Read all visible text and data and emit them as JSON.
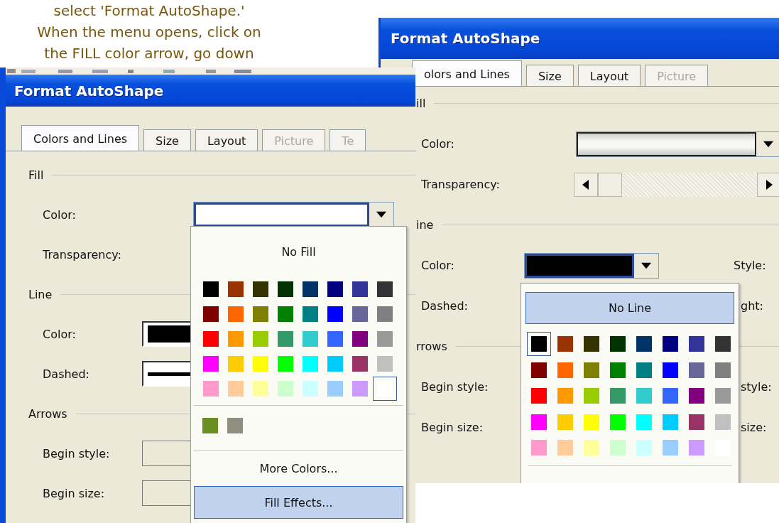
{
  "caption_lines": [
    "select 'Format AutoShape.'",
    "When the menu opens, click on",
    "the FILL color arrow, go down"
  ],
  "back_window": {
    "title": "Format AutoShape",
    "tabs": [
      {
        "label": "olors and Lines",
        "selected": true,
        "disabled": false
      },
      {
        "label": "Size",
        "selected": false,
        "disabled": false
      },
      {
        "label": "Layout",
        "selected": false,
        "disabled": false
      },
      {
        "label": "Picture",
        "selected": false,
        "disabled": true
      }
    ],
    "fill": {
      "heading": "ill",
      "color_label": "Color:",
      "color": "#f6f6f2",
      "transparency_label": "Transparency:",
      "level": 0
    },
    "line": {
      "heading": "ine",
      "color_label": "Color:",
      "color": "#000000",
      "style_label": "Style:",
      "dashed_label": "Dashed:",
      "weight_label": "ght:"
    },
    "arrows": {
      "heading": "rrows",
      "begin_style_label": "Begin style:",
      "end_style_label": "style:",
      "begin_size_label": "Begin size:",
      "end_size_label": "size:"
    },
    "popup": {
      "top_item": {
        "label": "No Line",
        "selected": true
      },
      "swatches": [
        {
          "color": "#000000",
          "selected": true
        },
        {
          "color": "#993300",
          "selected": false
        },
        {
          "color": "#333300",
          "selected": false
        },
        {
          "color": "#003300",
          "selected": false
        },
        {
          "color": "#003366",
          "selected": false
        },
        {
          "color": "#000080",
          "selected": false
        },
        {
          "color": "#333399",
          "selected": false
        },
        {
          "color": "#333333",
          "selected": false
        },
        {
          "color": "#800000",
          "selected": false
        },
        {
          "color": "#ff6600",
          "selected": false
        },
        {
          "color": "#808000",
          "selected": false
        },
        {
          "color": "#008000",
          "selected": false
        },
        {
          "color": "#008080",
          "selected": false
        },
        {
          "color": "#0000ff",
          "selected": false
        },
        {
          "color": "#666699",
          "selected": false
        },
        {
          "color": "#808080",
          "selected": false
        },
        {
          "color": "#ff0000",
          "selected": false
        },
        {
          "color": "#ff9900",
          "selected": false
        },
        {
          "color": "#99cc00",
          "selected": false
        },
        {
          "color": "#339966",
          "selected": false
        },
        {
          "color": "#33cccc",
          "selected": false
        },
        {
          "color": "#3366ff",
          "selected": false
        },
        {
          "color": "#800080",
          "selected": false
        },
        {
          "color": "#999999",
          "selected": false
        },
        {
          "color": "#ff00ff",
          "selected": false
        },
        {
          "color": "#ffcc00",
          "selected": false
        },
        {
          "color": "#ffff00",
          "selected": false
        },
        {
          "color": "#00ff00",
          "selected": false
        },
        {
          "color": "#00ffff",
          "selected": false
        },
        {
          "color": "#00ccff",
          "selected": false
        },
        {
          "color": "#993366",
          "selected": false
        },
        {
          "color": "#c0c0c0",
          "selected": false
        },
        {
          "color": "#ff99cc",
          "selected": false
        },
        {
          "color": "#ffcc99",
          "selected": false
        },
        {
          "color": "#ffff99",
          "selected": false
        },
        {
          "color": "#ccffcc",
          "selected": false
        },
        {
          "color": "#ccffff",
          "selected": false
        },
        {
          "color": "#99ccff",
          "selected": false
        },
        {
          "color": "#cc99ff",
          "selected": false
        },
        {
          "color": "#ffffff",
          "selected": false
        }
      ]
    }
  },
  "front_window": {
    "title": "Format AutoShape",
    "tabs": [
      {
        "label": "Colors and Lines",
        "selected": true,
        "disabled": false
      },
      {
        "label": "Size",
        "selected": false,
        "disabled": false
      },
      {
        "label": "Layout",
        "selected": false,
        "disabled": false
      },
      {
        "label": "Picture",
        "selected": false,
        "disabled": true
      },
      {
        "label": "Te",
        "selected": false,
        "disabled": true
      }
    ],
    "fill": {
      "heading": "Fill",
      "color_label": "Color:",
      "color": "#ffffff",
      "transparency_label": "Transparency:"
    },
    "line": {
      "heading": "Line",
      "color_label": "Color:",
      "color": "#000000",
      "dashed_label": "Dashed:"
    },
    "arrows": {
      "heading": "Arrows",
      "begin_style_label": "Begin style:",
      "begin_size_label": "Begin size:"
    },
    "popup": {
      "top_item": {
        "label": "No Fill",
        "selected": false
      },
      "swatches": [
        {
          "color": "#000000",
          "selected": false
        },
        {
          "color": "#993300",
          "selected": false
        },
        {
          "color": "#333300",
          "selected": false
        },
        {
          "color": "#003300",
          "selected": false
        },
        {
          "color": "#003366",
          "selected": false
        },
        {
          "color": "#000080",
          "selected": false
        },
        {
          "color": "#333399",
          "selected": false
        },
        {
          "color": "#333333",
          "selected": false
        },
        {
          "color": "#800000",
          "selected": false
        },
        {
          "color": "#ff6600",
          "selected": false
        },
        {
          "color": "#808000",
          "selected": false
        },
        {
          "color": "#008000",
          "selected": false
        },
        {
          "color": "#008080",
          "selected": false
        },
        {
          "color": "#0000ff",
          "selected": false
        },
        {
          "color": "#666699",
          "selected": false
        },
        {
          "color": "#808080",
          "selected": false
        },
        {
          "color": "#ff0000",
          "selected": false
        },
        {
          "color": "#ff9900",
          "selected": false
        },
        {
          "color": "#99cc00",
          "selected": false
        },
        {
          "color": "#339966",
          "selected": false
        },
        {
          "color": "#33cccc",
          "selected": false
        },
        {
          "color": "#3366ff",
          "selected": false
        },
        {
          "color": "#800080",
          "selected": false
        },
        {
          "color": "#999999",
          "selected": false
        },
        {
          "color": "#ff00ff",
          "selected": false
        },
        {
          "color": "#ffcc00",
          "selected": false
        },
        {
          "color": "#ffff00",
          "selected": false
        },
        {
          "color": "#00ff00",
          "selected": false
        },
        {
          "color": "#00ffff",
          "selected": false
        },
        {
          "color": "#00ccff",
          "selected": false
        },
        {
          "color": "#993366",
          "selected": false
        },
        {
          "color": "#c0c0c0",
          "selected": false
        },
        {
          "color": "#ff99cc",
          "selected": false
        },
        {
          "color": "#ffcc99",
          "selected": false
        },
        {
          "color": "#ffff99",
          "selected": false
        },
        {
          "color": "#ccffcc",
          "selected": false
        },
        {
          "color": "#ccffff",
          "selected": false
        },
        {
          "color": "#99ccff",
          "selected": false
        },
        {
          "color": "#cc99ff",
          "selected": false
        },
        {
          "color": "#ffffff",
          "selected": true
        }
      ],
      "recent": [
        {
          "color": "#6b8e23"
        },
        {
          "color": "#8f8f80"
        }
      ],
      "items": [
        {
          "label": "More Colors...",
          "selected": false
        },
        {
          "label": "Fill Effects...",
          "selected": true
        }
      ]
    }
  }
}
